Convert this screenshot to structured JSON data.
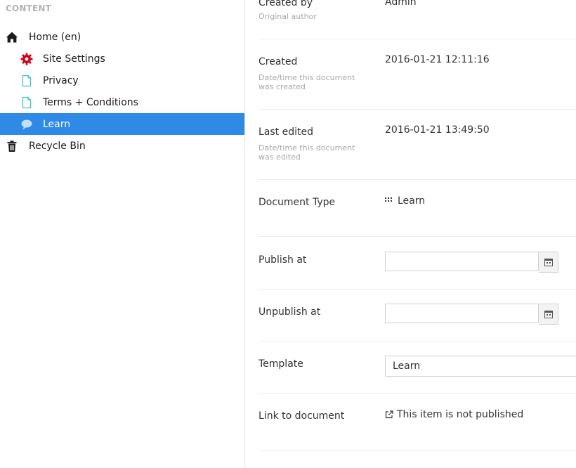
{
  "sidebar": {
    "heading": "CONTENT",
    "items": [
      {
        "label": "Home (en)",
        "icon": "home-icon"
      },
      {
        "label": "Site Settings",
        "icon": "gear-icon"
      },
      {
        "label": "Privacy",
        "icon": "document-icon"
      },
      {
        "label": "Terms + Conditions",
        "icon": "document-icon"
      },
      {
        "label": "Learn",
        "icon": "speech-bubble-icon",
        "selected": true
      },
      {
        "label": "Recycle Bin",
        "icon": "trash-icon"
      }
    ]
  },
  "properties": {
    "created_by": {
      "label": "Created by",
      "description": "Original author",
      "value": "Admin"
    },
    "created": {
      "label": "Created",
      "description": "Date/time this document was created",
      "value": "2016-01-21 12:11:16"
    },
    "last_edited": {
      "label": "Last edited",
      "description": "Date/time this document was edited",
      "value": "2016-01-21 13:49:50"
    },
    "document_type": {
      "label": "Document Type",
      "value": "Learn"
    },
    "publish_at": {
      "label": "Publish at",
      "value": ""
    },
    "unpublish_at": {
      "label": "Unpublish at",
      "value": ""
    },
    "template": {
      "label": "Template",
      "value": "Learn"
    },
    "link_to_document": {
      "label": "Link to document",
      "value": "This item is not published"
    }
  },
  "colors": {
    "selection": "#2e8ae6",
    "settings_icon": "#d0021b",
    "document_icon": "#3fc1c9"
  }
}
